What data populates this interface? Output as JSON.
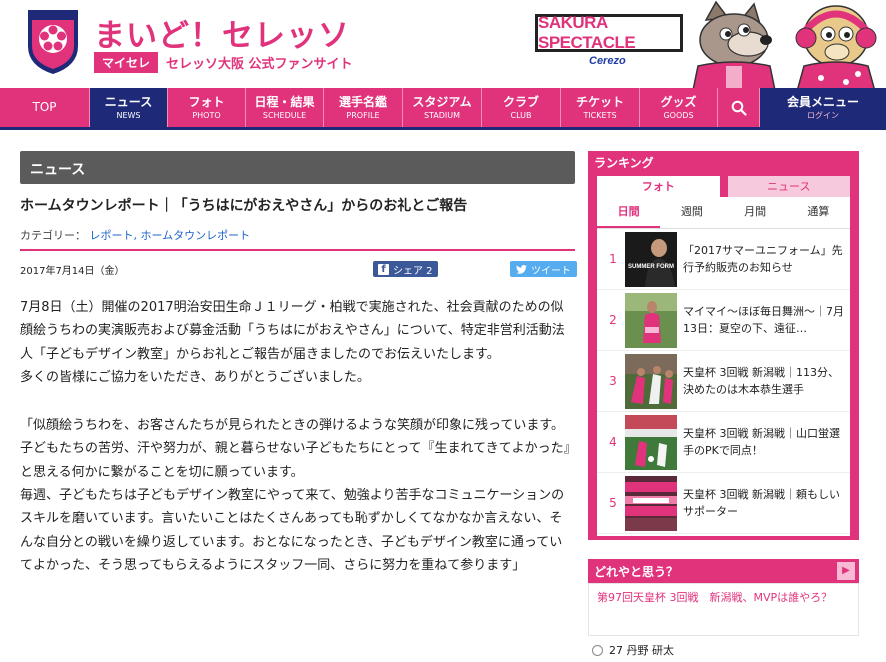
{
  "header": {
    "site_title": "まいど！セレッソ",
    "sub_badge": "マイセレ",
    "sub_text": "セレッソ大阪 公式ファンサイト",
    "spectacle": "SAKURA SPECTACLE",
    "spectacle_logo": "Cerezo"
  },
  "nav": {
    "items": [
      {
        "ja": "TOP",
        "en": ""
      },
      {
        "ja": "ニュース",
        "en": "NEWS"
      },
      {
        "ja": "フォト",
        "en": "PHOTO"
      },
      {
        "ja": "日程・結果",
        "en": "SCHEDULE"
      },
      {
        "ja": "選手名鑑",
        "en": "PROFILE"
      },
      {
        "ja": "スタジアム",
        "en": "STADIUM"
      },
      {
        "ja": "クラブ",
        "en": "CLUB"
      },
      {
        "ja": "チケット",
        "en": "TICKETS"
      },
      {
        "ja": "グッズ",
        "en": "GOODS"
      }
    ],
    "member_ja": "会員メニュー",
    "member_en": "ログイン"
  },
  "article": {
    "section": "ニュース",
    "title": "ホームタウンレポート｜「うちはにがおえやさん」からのお礼とご報告",
    "category_label": "カテゴリー：",
    "category_links": "レポート, ホームタウンレポート",
    "date": "2017年7月14日（金）",
    "share_label": "シェア 2",
    "tweet_label": "ツイート",
    "paragraphs": [
      "7月8日（土）開催の2017明治安田生命Ｊ１リーグ・柏戦で実施された、社会貢献のための似顔絵うちわの実演販売および募金活動「うちはにがおえやさん」について、特定非営利活動法人「子どもデザイン教室」からお礼とご報告が届きましたのでお伝えいたします。",
      "多くの皆様にご協力をいただき、ありがとうございました。",
      "「似顔絵うちわを、お客さんたちが見られたときの弾けるような笑顔が印象に残っています。子どもたちの苦労、汗や努力が、親と暮らせない子どもたちにとって『生まれてきてよかった』と思える何かに繋がることを切に願っています。",
      "毎週、子どもたちは子どもデザイン教室にやって来て、勉強より苦手なコミュニケーションのスキルを磨いています。言いたいことはたくさんあっても恥ずかしくてなかなか言えない、そんな自分との戦いを繰り返しています。おとなになったとき、子どもデザイン教室に通っていてよかった、そう思ってもらえるようにスタッフ一同、さらに努力を重ねて参ります」"
    ]
  },
  "ranking": {
    "heading": "ランキング",
    "tabs": [
      "フォト",
      "ニュース"
    ],
    "periods": [
      "日間",
      "週間",
      "月間",
      "通算"
    ],
    "items": [
      {
        "rank": "1",
        "text": "「2017サマーユニフォーム」先行予約販売のお知らせ",
        "thumb_caption": "SUMMER FORM"
      },
      {
        "rank": "2",
        "text": "マイマイ～ほぼ毎日舞洲～｜7月13日：夏空の下、遠征…"
      },
      {
        "rank": "3",
        "text": "天皇杯 3回戦 新潟戦｜113分、決めたのは木本恭生選手"
      },
      {
        "rank": "4",
        "text": "天皇杯 3回戦 新潟戦｜山口蛍選手のPKで同点！"
      },
      {
        "rank": "5",
        "text": "天皇杯 3回戦 新潟戦｜頼もしいサポーター"
      }
    ]
  },
  "vote": {
    "heading": "どれやと思う？",
    "question": "第97回天皇杯 3回戦　新潟戦、MVPは誰やろ？",
    "option": "27 丹野 研太"
  },
  "colors": {
    "brand_pink": "#e1337c",
    "navy": "#1e2a78",
    "link_blue": "#1e64c8"
  }
}
